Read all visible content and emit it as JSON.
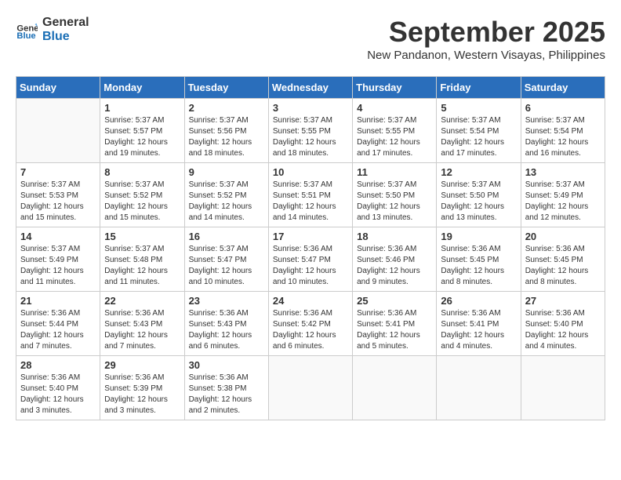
{
  "header": {
    "logo_line1": "General",
    "logo_line2": "Blue",
    "month_title": "September 2025",
    "location": "New Pandanon, Western Visayas, Philippines"
  },
  "weekdays": [
    "Sunday",
    "Monday",
    "Tuesday",
    "Wednesday",
    "Thursday",
    "Friday",
    "Saturday"
  ],
  "weeks": [
    [
      {
        "day": "",
        "info": ""
      },
      {
        "day": "1",
        "info": "Sunrise: 5:37 AM\nSunset: 5:57 PM\nDaylight: 12 hours\nand 19 minutes."
      },
      {
        "day": "2",
        "info": "Sunrise: 5:37 AM\nSunset: 5:56 PM\nDaylight: 12 hours\nand 18 minutes."
      },
      {
        "day": "3",
        "info": "Sunrise: 5:37 AM\nSunset: 5:55 PM\nDaylight: 12 hours\nand 18 minutes."
      },
      {
        "day": "4",
        "info": "Sunrise: 5:37 AM\nSunset: 5:55 PM\nDaylight: 12 hours\nand 17 minutes."
      },
      {
        "day": "5",
        "info": "Sunrise: 5:37 AM\nSunset: 5:54 PM\nDaylight: 12 hours\nand 17 minutes."
      },
      {
        "day": "6",
        "info": "Sunrise: 5:37 AM\nSunset: 5:54 PM\nDaylight: 12 hours\nand 16 minutes."
      }
    ],
    [
      {
        "day": "7",
        "info": "Sunrise: 5:37 AM\nSunset: 5:53 PM\nDaylight: 12 hours\nand 15 minutes."
      },
      {
        "day": "8",
        "info": "Sunrise: 5:37 AM\nSunset: 5:52 PM\nDaylight: 12 hours\nand 15 minutes."
      },
      {
        "day": "9",
        "info": "Sunrise: 5:37 AM\nSunset: 5:52 PM\nDaylight: 12 hours\nand 14 minutes."
      },
      {
        "day": "10",
        "info": "Sunrise: 5:37 AM\nSunset: 5:51 PM\nDaylight: 12 hours\nand 14 minutes."
      },
      {
        "day": "11",
        "info": "Sunrise: 5:37 AM\nSunset: 5:50 PM\nDaylight: 12 hours\nand 13 minutes."
      },
      {
        "day": "12",
        "info": "Sunrise: 5:37 AM\nSunset: 5:50 PM\nDaylight: 12 hours\nand 13 minutes."
      },
      {
        "day": "13",
        "info": "Sunrise: 5:37 AM\nSunset: 5:49 PM\nDaylight: 12 hours\nand 12 minutes."
      }
    ],
    [
      {
        "day": "14",
        "info": "Sunrise: 5:37 AM\nSunset: 5:49 PM\nDaylight: 12 hours\nand 11 minutes."
      },
      {
        "day": "15",
        "info": "Sunrise: 5:37 AM\nSunset: 5:48 PM\nDaylight: 12 hours\nand 11 minutes."
      },
      {
        "day": "16",
        "info": "Sunrise: 5:37 AM\nSunset: 5:47 PM\nDaylight: 12 hours\nand 10 minutes."
      },
      {
        "day": "17",
        "info": "Sunrise: 5:36 AM\nSunset: 5:47 PM\nDaylight: 12 hours\nand 10 minutes."
      },
      {
        "day": "18",
        "info": "Sunrise: 5:36 AM\nSunset: 5:46 PM\nDaylight: 12 hours\nand 9 minutes."
      },
      {
        "day": "19",
        "info": "Sunrise: 5:36 AM\nSunset: 5:45 PM\nDaylight: 12 hours\nand 8 minutes."
      },
      {
        "day": "20",
        "info": "Sunrise: 5:36 AM\nSunset: 5:45 PM\nDaylight: 12 hours\nand 8 minutes."
      }
    ],
    [
      {
        "day": "21",
        "info": "Sunrise: 5:36 AM\nSunset: 5:44 PM\nDaylight: 12 hours\nand 7 minutes."
      },
      {
        "day": "22",
        "info": "Sunrise: 5:36 AM\nSunset: 5:43 PM\nDaylight: 12 hours\nand 7 minutes."
      },
      {
        "day": "23",
        "info": "Sunrise: 5:36 AM\nSunset: 5:43 PM\nDaylight: 12 hours\nand 6 minutes."
      },
      {
        "day": "24",
        "info": "Sunrise: 5:36 AM\nSunset: 5:42 PM\nDaylight: 12 hours\nand 6 minutes."
      },
      {
        "day": "25",
        "info": "Sunrise: 5:36 AM\nSunset: 5:41 PM\nDaylight: 12 hours\nand 5 minutes."
      },
      {
        "day": "26",
        "info": "Sunrise: 5:36 AM\nSunset: 5:41 PM\nDaylight: 12 hours\nand 4 minutes."
      },
      {
        "day": "27",
        "info": "Sunrise: 5:36 AM\nSunset: 5:40 PM\nDaylight: 12 hours\nand 4 minutes."
      }
    ],
    [
      {
        "day": "28",
        "info": "Sunrise: 5:36 AM\nSunset: 5:40 PM\nDaylight: 12 hours\nand 3 minutes."
      },
      {
        "day": "29",
        "info": "Sunrise: 5:36 AM\nSunset: 5:39 PM\nDaylight: 12 hours\nand 3 minutes."
      },
      {
        "day": "30",
        "info": "Sunrise: 5:36 AM\nSunset: 5:38 PM\nDaylight: 12 hours\nand 2 minutes."
      },
      {
        "day": "",
        "info": ""
      },
      {
        "day": "",
        "info": ""
      },
      {
        "day": "",
        "info": ""
      },
      {
        "day": "",
        "info": ""
      }
    ]
  ]
}
